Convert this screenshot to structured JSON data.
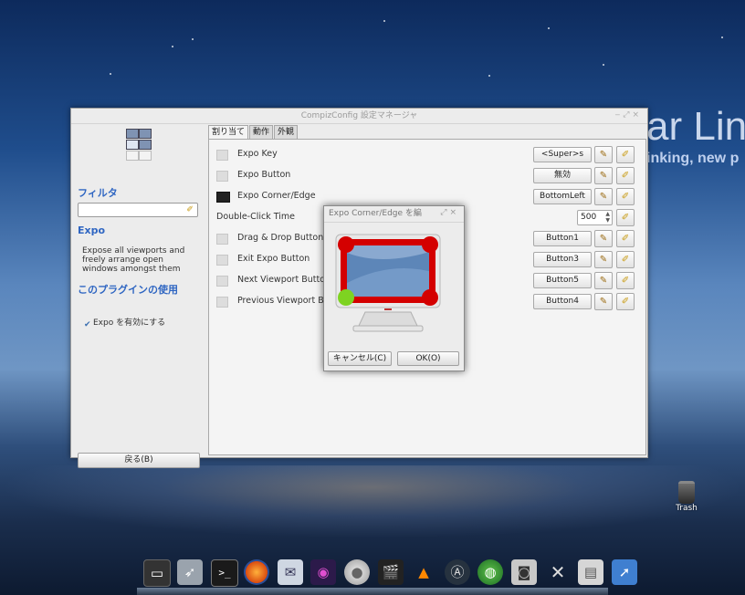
{
  "desktop": {
    "brand_text": "ar Lin",
    "tagline": "inking, new p",
    "trash_label": "Trash"
  },
  "window": {
    "title": "CompizConfig 設定マネージャ",
    "sidebar": {
      "filter_heading": "フィルタ",
      "filter_value": "",
      "plugin_heading": "Expo",
      "description": "Expose all viewports and freely arrange open windows amongst them",
      "use_heading": "このプラグインの使用",
      "enable_label": "Expo を有効にする",
      "back_button": "戻る(B)"
    },
    "tabs": [
      {
        "label": "割り当て",
        "active": true
      },
      {
        "label": "動作",
        "active": false
      },
      {
        "label": "外観",
        "active": false
      }
    ],
    "rows": [
      {
        "label": "Expo Key",
        "value": "<Super>s"
      },
      {
        "label": "Expo Button",
        "value": "無効"
      },
      {
        "label": "Expo Corner/Edge",
        "value": "BottomLeft"
      },
      {
        "label": "Double-Click Time",
        "value": "500"
      },
      {
        "label": "Drag & Drop Button",
        "value": "Button1"
      },
      {
        "label": "Exit Expo Button",
        "value": "Button3"
      },
      {
        "label": "Next Viewport Button",
        "value": "Button5"
      },
      {
        "label": "Previous Viewport Button",
        "value": "Button4"
      }
    ]
  },
  "dialog": {
    "title": "Expo Corner/Edge を編",
    "cancel_button": "キャンセル(C)",
    "ok_button": "OK(O)",
    "selected_corner": "bottom-left",
    "corner_color": "#d40000",
    "selected_color": "#7ed321"
  },
  "dock": {
    "icons": [
      "monitor-icon",
      "rocket-icon",
      "terminal-icon",
      "firefox-icon",
      "mail-icon",
      "eye-icon",
      "disc-icon",
      "vlc-icon",
      "appstore-icon",
      "globe-icon",
      "camera-icon",
      "tools-icon",
      "drive-icon",
      "cursor-icon"
    ]
  }
}
